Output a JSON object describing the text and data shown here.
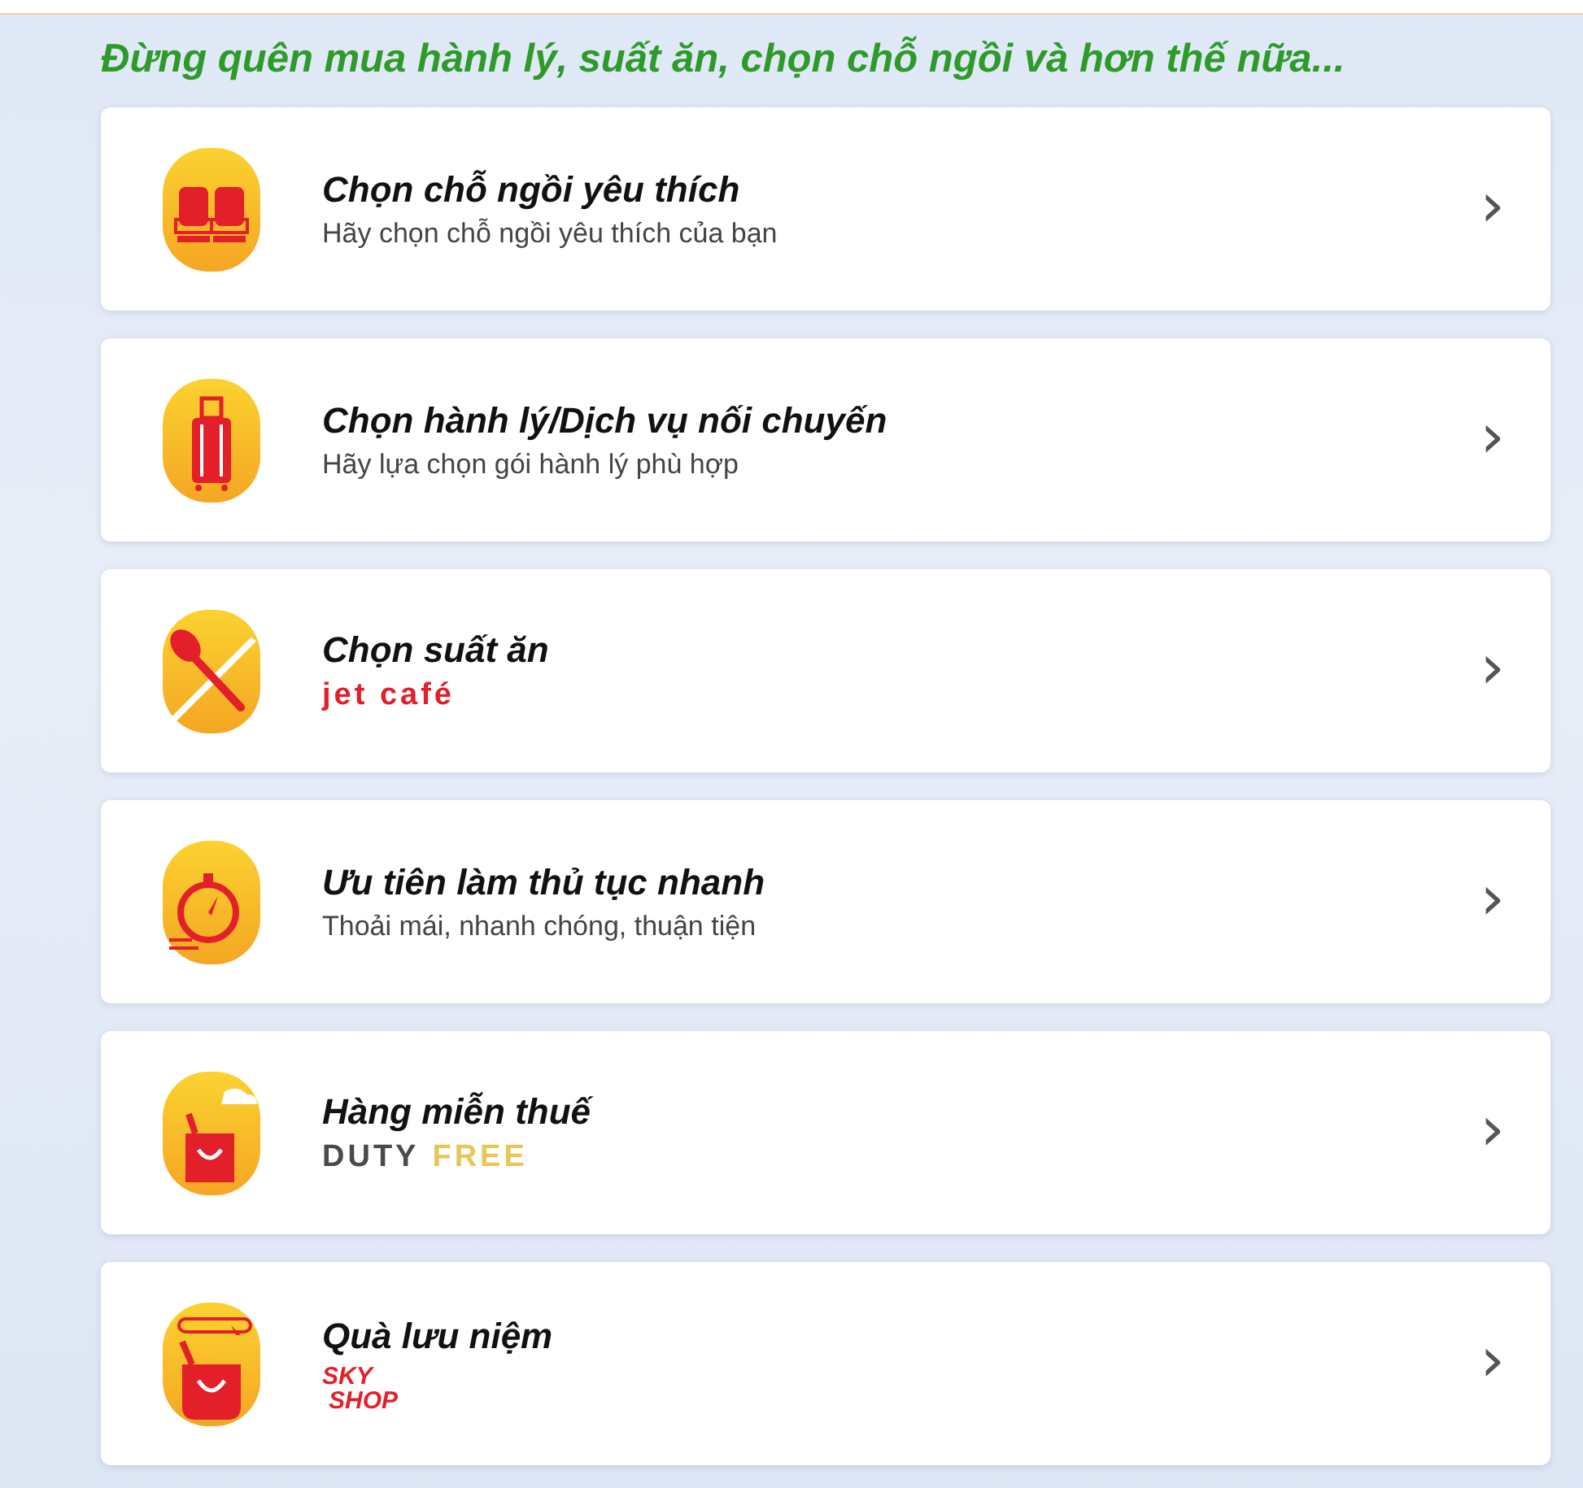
{
  "heading": "Đừng quên mua hành lý, suất ăn, chọn chỗ ngồi và hơn thế nữa...",
  "services": [
    {
      "title": "Chọn chỗ ngồi yêu thích",
      "subtitle": {
        "kind": "text",
        "text": "Hãy chọn chỗ ngồi yêu thích của bạn"
      },
      "chevron": "›"
    },
    {
      "title": "Chọn hành lý/Dịch vụ nối chuyến",
      "subtitle": {
        "kind": "text",
        "text": "Hãy lựa chọn gói hành lý phù hợp"
      },
      "chevron": "›"
    },
    {
      "title": "Chọn suất ăn",
      "subtitle": {
        "kind": "logo",
        "parts": [
          {
            "text": "jet café",
            "color": "#e3202a"
          }
        ]
      },
      "chevron": "›"
    },
    {
      "title": "Ưu tiên làm thủ tục nhanh",
      "subtitle": {
        "kind": "text",
        "text": "Thoải mái, nhanh chóng, thuận tiện"
      },
      "chevron": "›"
    },
    {
      "title": "Hàng miễn thuế",
      "subtitle": {
        "kind": "logo",
        "parts": [
          {
            "text": "DUTY",
            "color": "#4a4a4a"
          },
          {
            "text": "FREE",
            "color": "#e8c65a"
          }
        ]
      },
      "chevron": "›"
    },
    {
      "title": "Quà lưu niệm",
      "subtitle": {
        "kind": "stacked-logo",
        "parts": [
          {
            "text": "SKY",
            "color": "#e3202a"
          },
          {
            "text": "SHOP",
            "color": "#e3202a"
          }
        ]
      },
      "chevron": "›"
    }
  ]
}
